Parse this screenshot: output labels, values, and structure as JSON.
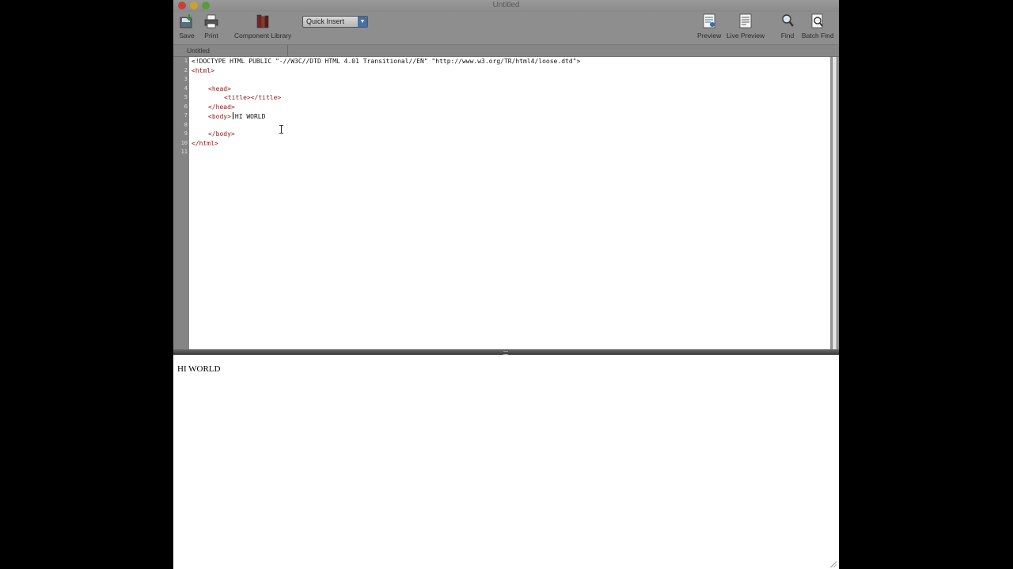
{
  "window": {
    "title": "Untitled"
  },
  "toolbar": {
    "save_label": "Save",
    "print_label": "Print",
    "component_library_label": "Component Library",
    "selector_value": "Quick Insert",
    "preview_label": "Preview",
    "live_preview_label": "Live Preview",
    "find_label": "Find",
    "batch_find_label": "Batch Find"
  },
  "icons": {
    "save": "save-icon",
    "print": "printer-icon",
    "component_library": "books-icon",
    "preview": "document-preview-icon",
    "live_preview": "document-live-preview-icon",
    "find": "magnifier-icon",
    "batch_find": "batch-find-icon"
  },
  "tabs": [
    {
      "label": "Untitled"
    }
  ],
  "editor": {
    "line_numbers": [
      "1",
      "2",
      "3",
      "4",
      "5",
      "6",
      "7",
      "8",
      "9",
      "10",
      "11"
    ],
    "lines": {
      "l1": "<!DOCTYPE HTML PUBLIC \"-//W3C//DTD HTML 4.01 Transitional//EN\" \"http://www.w3.org/TR/html4/loose.dtd\">",
      "l2": "<html>",
      "l4": "<head>",
      "l5": "<title></title>",
      "l6": "</head>",
      "l7_tag": "<body>",
      "l7_text": "HI WORLD",
      "l9": "</body>",
      "l10": "</html>"
    }
  },
  "preview": {
    "text": "HI WORLD"
  },
  "colors": {
    "chrome": "#8e8e8e",
    "tag": "#8b1a1a",
    "editor_bg": "#ffffff"
  }
}
